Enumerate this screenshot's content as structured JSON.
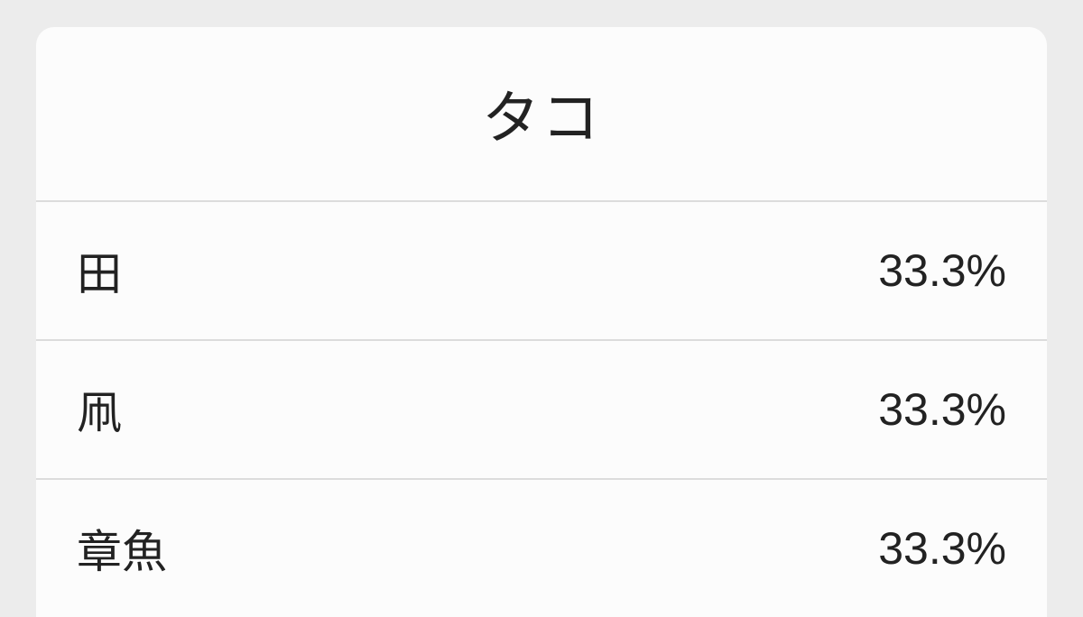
{
  "card": {
    "title": "タコ",
    "rows": [
      {
        "label": "田",
        "value": "33.3%"
      },
      {
        "label": "凧",
        "value": "33.3%"
      },
      {
        "label": "章魚",
        "value": "33.3%"
      }
    ]
  }
}
